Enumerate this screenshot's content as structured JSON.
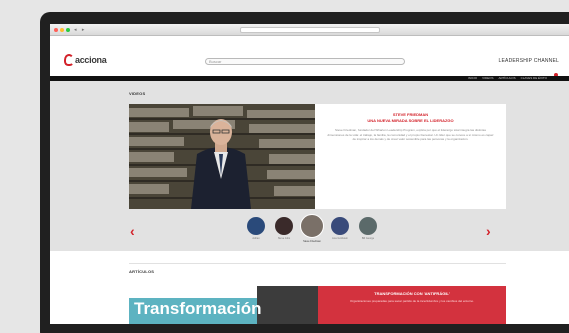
{
  "header": {
    "logo_text": "acciona",
    "search_placeholder": "Buscar",
    "channel": "LEADERSHIP CHANNEL"
  },
  "menu": {
    "items": [
      "INICIO",
      "VIDEOS",
      "ARTÍCULOS",
      "CLAVES DE ÉXITO"
    ]
  },
  "videos": {
    "section_label": "VIDEOS",
    "feature": {
      "name": "STEVE FRIEDMAN",
      "title": "UNA NUEVA MIRADA SOBRE EL LIDERAZGO",
      "body": "Steve Friedman, fundador del Wharton Leadership Program, explica por qué el liderazgo total integra las distintas dimensiones de la vida: el trabajo, la familia, la comunidad y el propio bienestar. Un líder que se conoce a sí mismo es capaz de inspirar a los demás y de crear valor sostenible para las personas y la organización."
    },
    "thumbs": [
      {
        "caption": "Adrian",
        "color": "#2a4a7a"
      },
      {
        "caption": "Steve Jobs",
        "color": "#3a2a2a"
      },
      {
        "caption": "Steve Friedman",
        "color": "#7a7068"
      },
      {
        "caption": "Lisa Goldstein",
        "color": "#394a7a"
      },
      {
        "caption": "Bill George",
        "color": "#5b6a6a"
      }
    ]
  },
  "articles": {
    "section_label": "ARTÍCULOS",
    "feature": {
      "headline": "Transformación",
      "title": "TRANSFORMACIÓN CON 'ANTIFRÁGIL'",
      "body": "Organizaciones preparadas para sacar partido de la incertidumbre y los cambios del entorno."
    }
  },
  "colors": {
    "brand_red": "#d3222a",
    "menubar": "#111111",
    "bezel": "#202020"
  },
  "icons": {
    "prev": "chevron-left-icon",
    "next": "chevron-right-icon"
  }
}
